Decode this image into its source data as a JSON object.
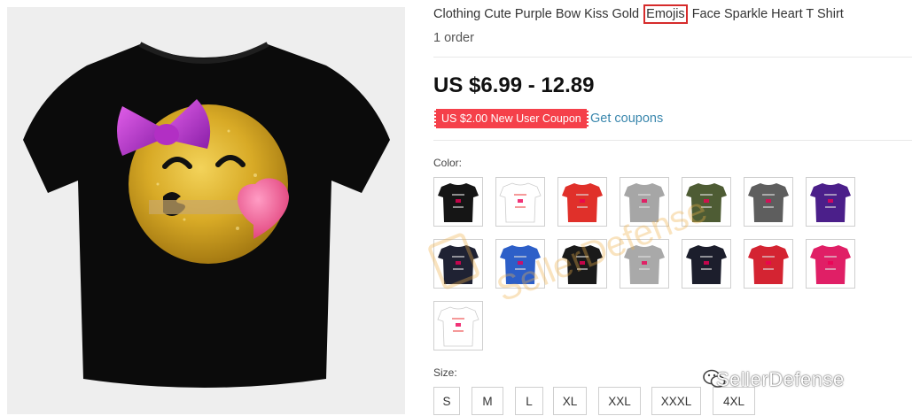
{
  "product": {
    "title_before": "Clothing Cute Purple Bow Kiss Gold",
    "title_highlight": "Emojis",
    "title_after": "Face Sparkle Heart T Shirt",
    "orders": "1 order",
    "price": "US $6.99 - 12.89",
    "coupon": "US $2.00 New User Coupon",
    "get_coupons": "Get coupons",
    "highlight_color": "#d62b2b"
  },
  "colors": {
    "label": "Color:",
    "swatches": [
      {
        "name": "black",
        "color": "#151515"
      },
      {
        "name": "white",
        "color": "#ffffff"
      },
      {
        "name": "red",
        "color": "#e0302a"
      },
      {
        "name": "gray",
        "color": "#a6a6a6"
      },
      {
        "name": "army-green",
        "color": "#4e5c34"
      },
      {
        "name": "dark-gray",
        "color": "#5e5e5e"
      },
      {
        "name": "purple",
        "color": "#4b1f8a"
      },
      {
        "name": "navy",
        "color": "#1f2233"
      },
      {
        "name": "blue",
        "color": "#2d5fc8"
      },
      {
        "name": "black-2",
        "color": "#1a1a1a"
      },
      {
        "name": "light-gray",
        "color": "#a9a9a9"
      },
      {
        "name": "dark-navy",
        "color": "#1c1e2c"
      },
      {
        "name": "crimson",
        "color": "#d42432"
      },
      {
        "name": "pink",
        "color": "#e01f66"
      },
      {
        "name": "white-2",
        "color": "#ffffff"
      }
    ]
  },
  "sizes": {
    "label": "Size:",
    "options": [
      "S",
      "M",
      "L",
      "XL",
      "XXL",
      "XXXL",
      "4XL"
    ]
  },
  "watermark": {
    "text": "SellerDefense",
    "overlay_text": "SellerDefense"
  }
}
